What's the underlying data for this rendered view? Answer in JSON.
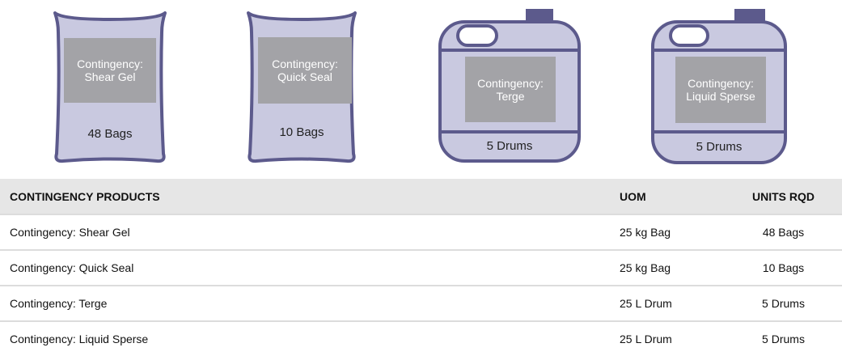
{
  "colors": {
    "container_fill": "#c9c9e0",
    "container_stroke": "#5c5a8c",
    "label_fill": "#a3a3a7",
    "header_bg": "#e6e6e6"
  },
  "packages": [
    {
      "kind": "bag",
      "icon": "bag-icon",
      "label_line1": "Contingency:",
      "label_line2": "Shear Gel",
      "quantity": "48 Bags"
    },
    {
      "kind": "bag",
      "icon": "bag-icon",
      "label_line1": "Contingency:",
      "label_line2": "Quick Seal",
      "quantity": "10 Bags"
    },
    {
      "kind": "drum",
      "icon": "drum-icon",
      "label_line1": "Contingency:",
      "label_line2": "Terge",
      "quantity": "5 Drums"
    },
    {
      "kind": "drum",
      "icon": "drum-icon",
      "label_line1": "Contingency:",
      "label_line2": "Liquid Sperse",
      "quantity": "5 Drums"
    }
  ],
  "table": {
    "headers": [
      "CONTINGENCY PRODUCTS",
      "UOM",
      "UNITS RQD"
    ],
    "rows": [
      [
        "Contingency: Shear Gel",
        "25 kg Bag",
        "48 Bags"
      ],
      [
        "Contingency: Quick Seal",
        "25 kg Bag",
        "10 Bags"
      ],
      [
        "Contingency: Terge",
        "25 L Drum",
        "5 Drums"
      ],
      [
        "Contingency: Liquid Sperse",
        "25 L Drum",
        "5 Drums"
      ]
    ]
  }
}
